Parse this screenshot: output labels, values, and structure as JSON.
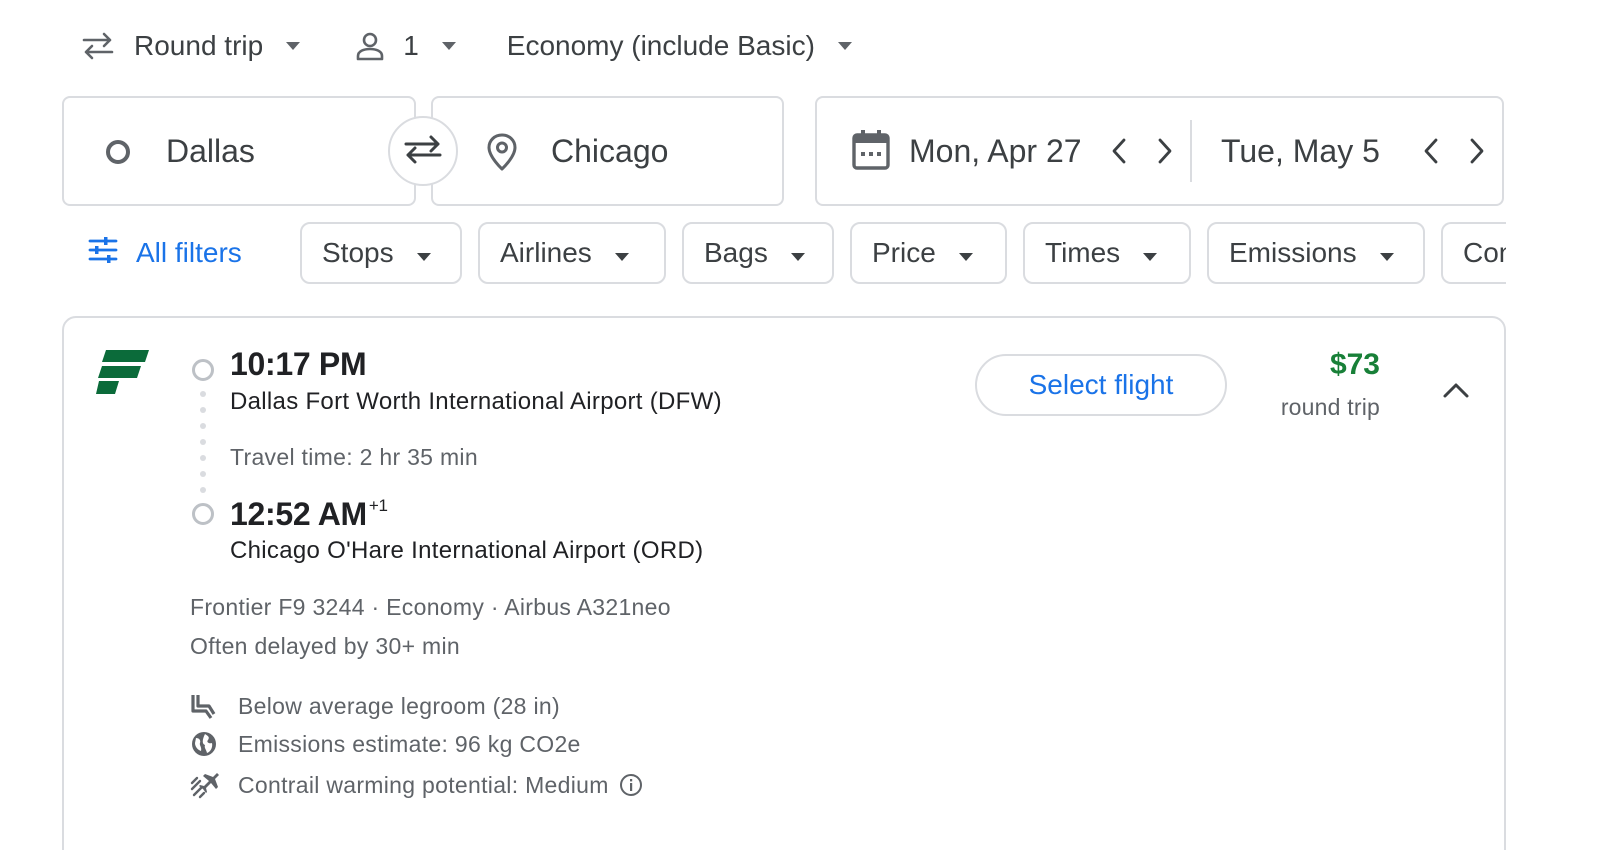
{
  "trip_options": {
    "trip_type": "Round trip",
    "passengers": "1",
    "cabin": "Economy (include Basic)"
  },
  "search": {
    "origin": "Dallas",
    "destination": "Chicago",
    "depart_date": "Mon, Apr 27",
    "return_date": "Tue, May 5"
  },
  "filters": {
    "all_filters_label": "All filters",
    "chips": [
      "Stops",
      "Airlines",
      "Bags",
      "Price",
      "Times",
      "Emissions",
      "Connecting airports"
    ]
  },
  "flight": {
    "airline_logo": "frontier-logo",
    "depart_time": "10:17 PM",
    "depart_airport": "Dallas Fort Worth International Airport (DFW)",
    "travel_time": "Travel time: 2 hr 35 min",
    "arrive_time": "12:52 AM",
    "arrive_day_offset": "+1",
    "arrive_airport": "Chicago O'Hare International Airport (ORD)",
    "select_label": "Select flight",
    "price": "$73",
    "price_note": "round trip",
    "flight_info": "Frontier F9 3244 · Economy · Airbus A321neo",
    "delay_note": "Often delayed by 30+ min",
    "amenities": [
      {
        "icon": "legroom-seat-icon",
        "text": "Below average legroom (28 in)"
      },
      {
        "icon": "globe-icon",
        "text": "Emissions estimate: 96 kg CO2e"
      },
      {
        "icon": "contrail-plane-icon",
        "text": "Contrail warming potential: Medium"
      }
    ]
  },
  "colors": {
    "accent_blue": "#1a73e8",
    "price_green": "#188038",
    "frontier_green": "#0b6b3a",
    "border_gray": "#dadce0"
  }
}
